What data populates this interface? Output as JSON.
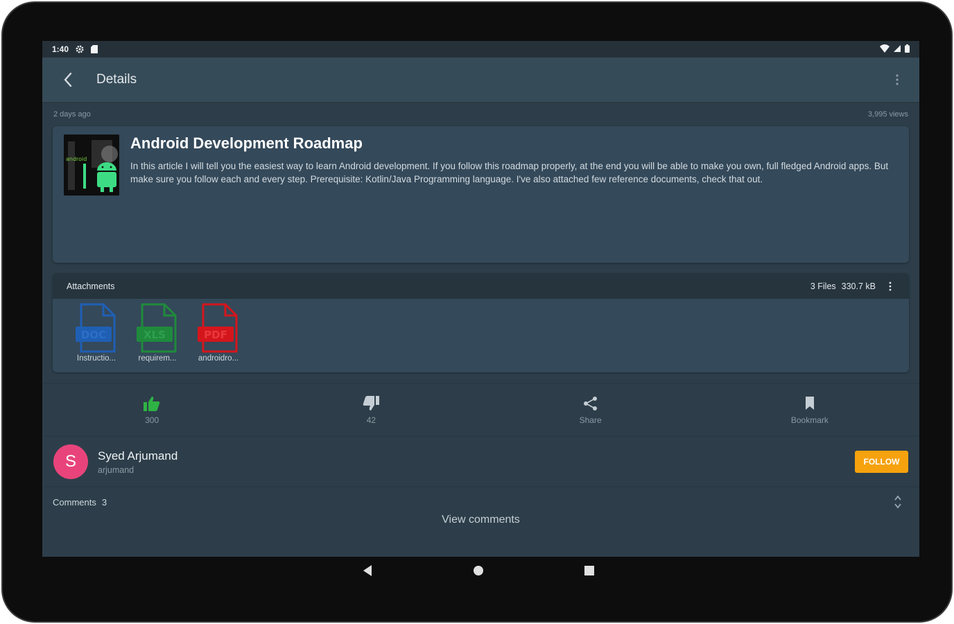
{
  "status_bar": {
    "time": "1:40",
    "icons_left": [
      "settings-gear-icon",
      "sd-card-icon"
    ],
    "icons_right": [
      "wifi-icon",
      "cell-signal-icon",
      "battery-icon"
    ]
  },
  "app_bar": {
    "title": "Details",
    "back_icon": "arrow-back-icon",
    "more_icon": "more-vert-icon"
  },
  "article": {
    "posted": "2 days ago",
    "views": "3,995 views",
    "title": "Android Development Roadmap",
    "body": "In this article I will tell you the easiest way to learn Android development. If you follow this roadmap properly, at the end you will be able to make you own, full fledged Android apps. But make sure you follow each and every step. Prerequisite: Kotlin/Java Programming language.  I've also attached few reference documents, check that out.",
    "thumbnail_text": "android"
  },
  "attachments": {
    "heading": "Attachments",
    "files_count": "3 Files",
    "total_size": "330.7 kB",
    "files": [
      {
        "type": "DOC",
        "name": "Instructio...",
        "color": "#1f5fb4"
      },
      {
        "type": "XLS",
        "name": "requirem...",
        "color": "#1f8a3c"
      },
      {
        "type": "PDF",
        "name": "androidro...",
        "color": "#d4161c"
      }
    ]
  },
  "actions": [
    {
      "icon": "thumb-up-icon",
      "label": "300",
      "color": "#2fb344"
    },
    {
      "icon": "thumb-down-icon",
      "label": "42",
      "color": "#c5ced4"
    },
    {
      "icon": "share-icon",
      "label": "Share",
      "color": "#c5ced4"
    },
    {
      "icon": "bookmark-icon",
      "label": "Bookmark",
      "color": "#c5ced4"
    }
  ],
  "author": {
    "initial": "S",
    "name": "Syed Arjumand",
    "handle": "arjumand",
    "follow_label": "Follow",
    "avatar_color": "#e8447b",
    "follow_color": "#f6a20e"
  },
  "comments": {
    "label": "Comments",
    "count": "3",
    "view_label": "View comments"
  },
  "nav_bar": [
    "nav-back-icon",
    "nav-home-icon",
    "nav-recents-icon"
  ]
}
